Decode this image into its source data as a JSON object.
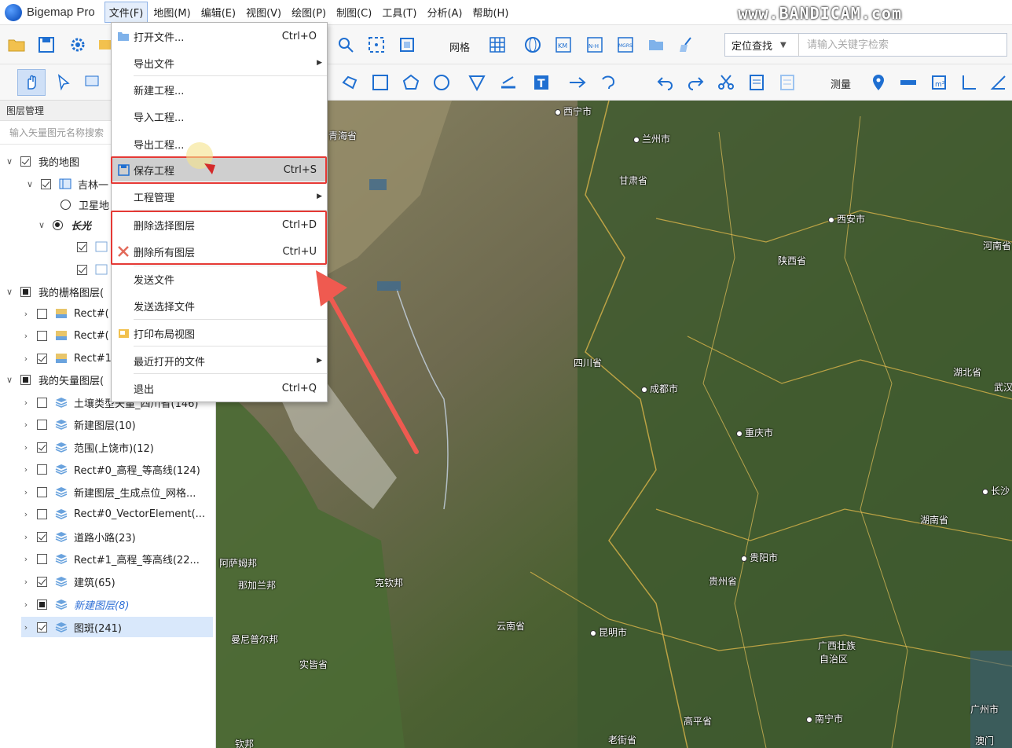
{
  "app": {
    "title": "Bigemap Pro",
    "watermark": "www.BANDICAM.com"
  },
  "menubar": [
    "文件(F)",
    "地图(M)",
    "编辑(E)",
    "视图(V)",
    "绘图(P)",
    "制图(C)",
    "工具(T)",
    "分析(A)",
    "帮助(H)"
  ],
  "toolbar": {
    "grid_label": "网格",
    "measure_label": "测量",
    "locate_option": "定位查找",
    "search_placeholder": "请输入关键字检索"
  },
  "layer_panel": {
    "title": "图层管理",
    "search_placeholder": "输入矢量图元名称搜索",
    "rows": [
      {
        "label": "我的地图",
        "expand": "∨"
      },
      {
        "label": "吉林一",
        "expand": "∨"
      },
      {
        "label": "卫星地"
      },
      {
        "label": "长光",
        "expand": "∨"
      },
      {
        "label": ""
      },
      {
        "label": ""
      },
      {
        "label": "我的栅格图层(",
        "expand": "∨"
      },
      {
        "label": "Rect#(",
        "expand": "›"
      },
      {
        "label": "Rect#(",
        "expand": "›"
      },
      {
        "label": "Rect#1",
        "expand": "›"
      },
      {
        "label": "我的矢量图层(",
        "expand": "∨"
      },
      {
        "label": "土壤类型矢量_四川省(146)",
        "expand": "›"
      },
      {
        "label": "新建图层(10)",
        "expand": "›"
      },
      {
        "label": "范围(上饶市)(12)",
        "expand": "›"
      },
      {
        "label": "Rect#0_高程_等高线(124)",
        "expand": "›"
      },
      {
        "label": "新建图层_生成点位_网格...",
        "expand": "›"
      },
      {
        "label": "Rect#0_VectorElement(...",
        "expand": "›"
      },
      {
        "label": "道路小路(23)",
        "expand": "›"
      },
      {
        "label": "Rect#1_高程_等高线(22...",
        "expand": "›"
      },
      {
        "label": "建筑(65)",
        "expand": "›"
      },
      {
        "label": "新建图层(8)",
        "expand": "›"
      },
      {
        "label": "图斑(241)",
        "expand": "›"
      }
    ]
  },
  "file_menu": {
    "items": [
      {
        "label": "打开文件...",
        "shortcut": "Ctrl+O"
      },
      {
        "label": "导出文件",
        "shortcut": ""
      },
      {
        "label": "新建工程...",
        "shortcut": ""
      },
      {
        "label": "导入工程...",
        "shortcut": ""
      },
      {
        "label": "导出工程...",
        "shortcut": ""
      },
      {
        "label": "保存工程",
        "shortcut": "Ctrl+S"
      },
      {
        "label": "工程管理",
        "shortcut": ""
      },
      {
        "label": "删除选择图层",
        "shortcut": "Ctrl+D"
      },
      {
        "label": "删除所有图层",
        "shortcut": "Ctrl+U"
      },
      {
        "label": "发送文件",
        "shortcut": ""
      },
      {
        "label": "发送选择文件",
        "shortcut": ""
      },
      {
        "label": "打印布局视图",
        "shortcut": ""
      },
      {
        "label": "最近打开的文件",
        "shortcut": ""
      },
      {
        "label": "退出",
        "shortcut": "Ctrl+Q"
      }
    ]
  },
  "map_labels": [
    "青海省",
    "西宁市",
    "兰州市",
    "甘肃省",
    "西安市",
    "河南省",
    "陕西省",
    "四川省",
    "成都市",
    "重庆市",
    "湖北省",
    "武汉",
    "长沙",
    "湖南省",
    "贵阳市",
    "贵州省",
    "云南省",
    "昆明市",
    "广西壮族",
    "自治区",
    "南宁市",
    "广州市",
    "高平省",
    "老街省",
    "澳门",
    "阿萨姆邦",
    "那加兰邦",
    "克钦邦",
    "曼尼普尔邦",
    "实皆省",
    "钦邦"
  ],
  "colors": {
    "highlight_border": "#e53935",
    "accent": "#1f6fd1",
    "map_base": "#3f5a2f"
  }
}
